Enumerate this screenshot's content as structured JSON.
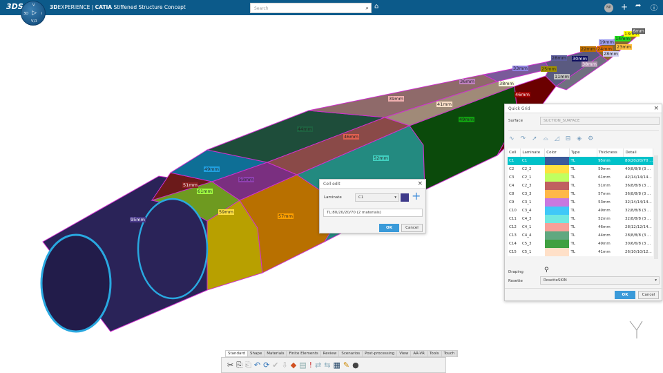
{
  "app": {
    "brand": "3DS",
    "compass": {
      "top": "V",
      "left": "3D",
      "right": "i",
      "bottom": "V,R"
    },
    "title_bold_1": "3D",
    "title_1": "EXPERIENCE | ",
    "title_bold_2": "CATIA",
    "title_2": " Stiffened Structure Concept",
    "search_placeholder": "Search",
    "avatar": "NP"
  },
  "viewport": {
    "labels": [
      "95mm",
      "51mm",
      "61mm",
      "49mm",
      "53mm",
      "59mm",
      "57mm",
      "44mm",
      "46mm",
      "52mm",
      "39mm",
      "41mm",
      "49mm",
      "46mm",
      "36mm",
      "38mm",
      "33mm",
      "25mm",
      "11mm",
      "28mm",
      "30mm",
      "38mm",
      "22mm",
      "24mm",
      "28mm",
      "19mm",
      "14mm",
      "23mm",
      "13mm",
      "6mm"
    ]
  },
  "quick_grid": {
    "title": "Quick Grid",
    "surface_label": "Surface",
    "surface_value": "SUCTION_SURFACE",
    "columns": [
      "Cell",
      "Laminate",
      "Color",
      "Type",
      "Thickness",
      "Detail"
    ],
    "rows": [
      {
        "cell": "C1",
        "laminate": "C1",
        "color": "#3a5a9a",
        "type": "TL",
        "thickness": "95mm",
        "detail": "80/20/20/70 ..."
      },
      {
        "cell": "C2",
        "laminate": "C2_2",
        "color": "#ffe040",
        "type": "TL",
        "thickness": "59mm",
        "detail": "40/8/8/8 (3 ..."
      },
      {
        "cell": "C3",
        "laminate": "C2_1",
        "color": "#c0ff60",
        "type": "TL",
        "thickness": "61mm",
        "detail": "42/14/14/14..."
      },
      {
        "cell": "C4",
        "laminate": "C2_3",
        "color": "#c06060",
        "type": "TL",
        "thickness": "51mm",
        "detail": "36/8/8/8 (3 ..."
      },
      {
        "cell": "C8",
        "laminate": "C3_3",
        "color": "#ffb848",
        "type": "TL",
        "thickness": "57mm",
        "detail": "36/8/8/8 (3 ..."
      },
      {
        "cell": "C9",
        "laminate": "C3_1",
        "color": "#c878e0",
        "type": "TL",
        "thickness": "53mm",
        "detail": "32/14/14/14..."
      },
      {
        "cell": "C10",
        "laminate": "C3_4",
        "color": "#40c8f8",
        "type": "TL",
        "thickness": "49mm",
        "detail": "32/8/8/8 (3 ..."
      },
      {
        "cell": "C11",
        "laminate": "C4_3",
        "color": "#70e8e0",
        "type": "TL",
        "thickness": "52mm",
        "detail": "32/8/8/8 (3 ..."
      },
      {
        "cell": "C12",
        "laminate": "C4_1",
        "color": "#f8a098",
        "type": "TL",
        "thickness": "46mm",
        "detail": "28/12/12/14..."
      },
      {
        "cell": "C13",
        "laminate": "C4_4",
        "color": "#60a880",
        "type": "TL",
        "thickness": "44mm",
        "detail": "28/8/8/8 (3 ..."
      },
      {
        "cell": "C14",
        "laminate": "C5_3",
        "color": "#40a040",
        "type": "TL",
        "thickness": "49mm",
        "detail": "30/6/6/8 (3 ..."
      },
      {
        "cell": "C15",
        "laminate": "C5_1",
        "color": "#ffe0c8",
        "type": "TL",
        "thickness": "41mm",
        "detail": "26/10/10/12..."
      }
    ],
    "draping_label": "Draping",
    "rosette_label": "Rosette",
    "rosette_value": "RosetteSKIN",
    "ok": "OK",
    "cancel": "Cancel"
  },
  "cell_edit": {
    "title": "Cell edit",
    "laminate_label": "Laminate",
    "laminate_value": "C1",
    "swatch_color": "#3e3a8a",
    "detail": "TL:80/20/20/70 (2 materials)",
    "ok": "OK",
    "cancel": "Cancel"
  },
  "toolbar": {
    "tabs": [
      "Standard",
      "Shape",
      "Materials",
      "Finite Elements",
      "Review",
      "Scenarios",
      "Post-processing",
      "View",
      "AR-VR",
      "Tools",
      "Touch"
    ],
    "active_tab": "Standard"
  }
}
